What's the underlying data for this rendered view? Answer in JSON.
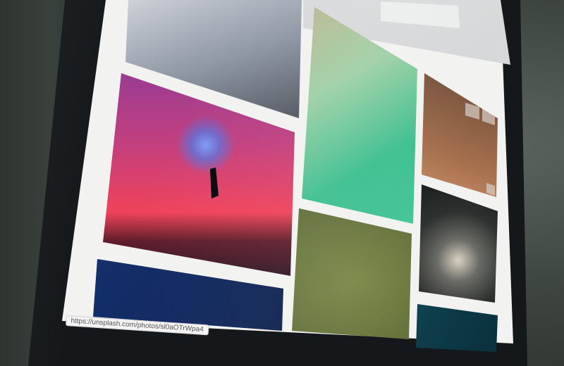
{
  "scene": "laptop screen showing a photo gallery grid",
  "browser": {
    "status_url": "https://unsplash.com/photos/sl0aOTrWpa4"
  },
  "gallery": {
    "tiles": [
      {
        "subject": "snowy glacier landscape"
      },
      {
        "subject": "person holding blue smoke flare at sunset"
      },
      {
        "subject": "dark blue ocean water"
      },
      {
        "subject": "aerial turquoise lake and sand"
      },
      {
        "subject": "aerial forest clearing"
      },
      {
        "subject": "warm-toned dim interior"
      },
      {
        "subject": "night sky with moon over landscape"
      },
      {
        "subject": "teal ocean wave"
      }
    ]
  },
  "colors": {
    "screen_background": "#f2f2f0",
    "bezel": "#15181a",
    "wall": "#3e4641"
  }
}
